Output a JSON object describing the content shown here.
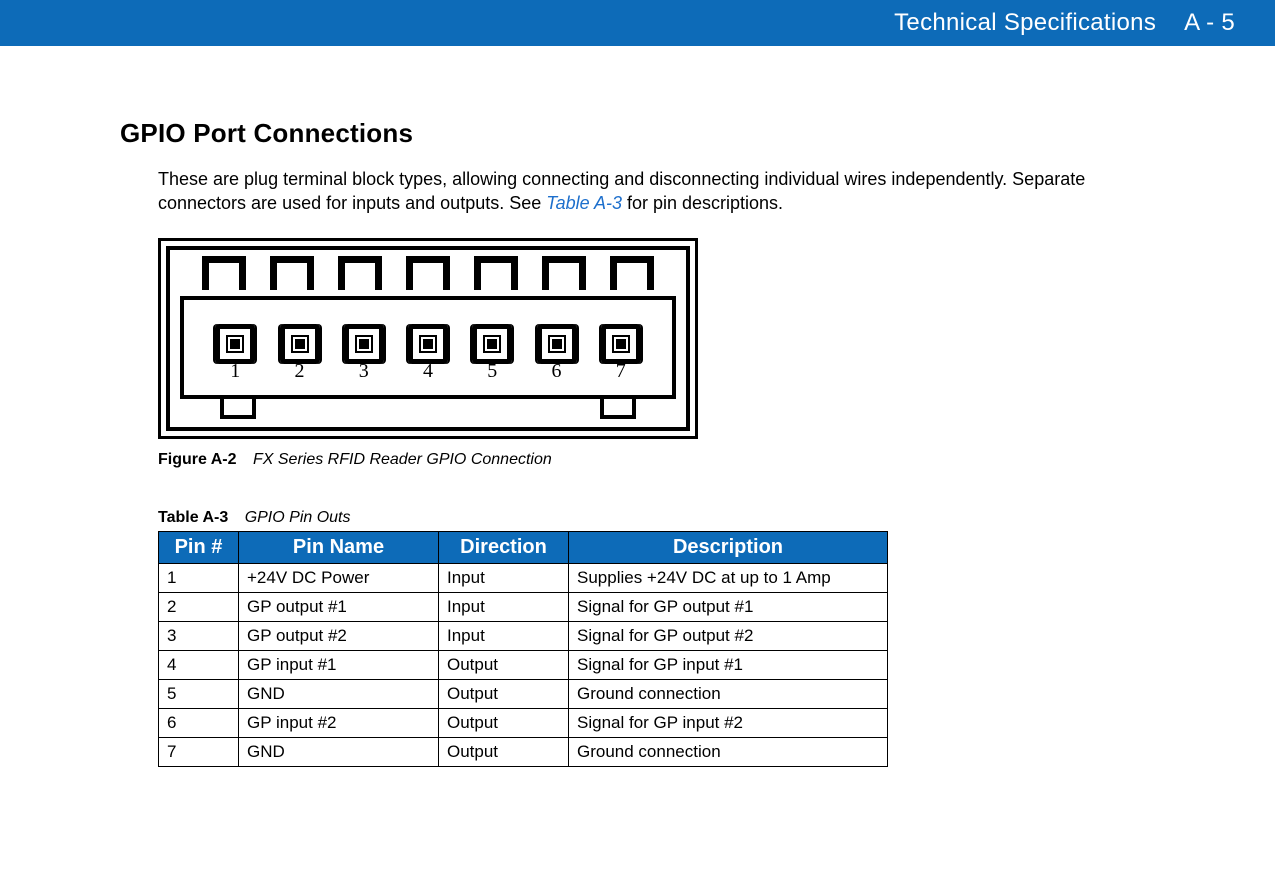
{
  "header": {
    "title": "Technical Specifications",
    "page": "A - 5"
  },
  "section": {
    "heading": "GPIO Port Connections",
    "para_before_ref": "These are plug terminal block types, allowing connecting and disconnecting individual wires independently. Separate connectors are used for inputs and outputs. See ",
    "ref": "Table A-3",
    "para_after_ref": " for pin descriptions."
  },
  "figure": {
    "pins": [
      "1",
      "2",
      "3",
      "4",
      "5",
      "6",
      "7"
    ],
    "label": "Figure A-2",
    "title": "FX Series RFID Reader GPIO Connection"
  },
  "table": {
    "label": "Table A-3",
    "title": "GPIO Pin Outs",
    "headers": [
      "Pin #",
      "Pin Name",
      "Direction",
      "Description"
    ],
    "rows": [
      {
        "pin": "1",
        "name": "+24V DC Power",
        "dir": "Input",
        "desc": "Supplies +24V DC at up to 1 Amp"
      },
      {
        "pin": "2",
        "name": "GP output #1",
        "dir": "Input",
        "desc": "Signal for GP output #1"
      },
      {
        "pin": "3",
        "name": "GP output #2",
        "dir": "Input",
        "desc": "Signal for GP output #2"
      },
      {
        "pin": "4",
        "name": "GP input #1",
        "dir": "Output",
        "desc": "Signal for GP input #1"
      },
      {
        "pin": "5",
        "name": "GND",
        "dir": "Output",
        "desc": "Ground connection"
      },
      {
        "pin": "6",
        "name": "GP input #2",
        "dir": "Output",
        "desc": "Signal for GP input #2"
      },
      {
        "pin": "7",
        "name": "GND",
        "dir": "Output",
        "desc": "Ground connection"
      }
    ]
  }
}
